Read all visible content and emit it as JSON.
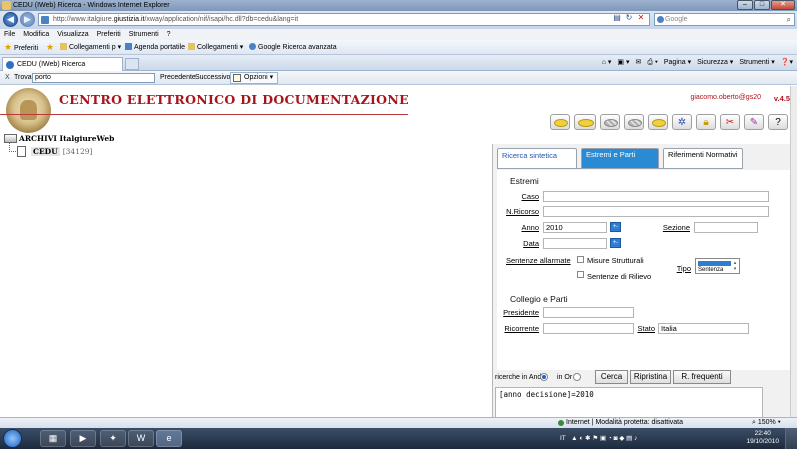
{
  "window": {
    "title": "CEDU (IWeb) Ricerca - Windows Internet Explorer"
  },
  "address": {
    "url_prefix": "http://www.italgiure.",
    "url_host": "giustizia.it",
    "url_suffix": "/xway/application/nif/isapi/hc.dll?db=cedu&lang=it",
    "search_placeholder": "Google"
  },
  "menu": [
    "File",
    "Modifica",
    "Visualizza",
    "Preferiti",
    "Strumenti",
    "?"
  ],
  "favorites": {
    "preferiti": "Preferiti",
    "collegamenti_p": "Collegamenti p",
    "agenda": "Agenda portatile",
    "collegamenti": "Collegamenti",
    "google": "Google Ricerca avanzata"
  },
  "tab": {
    "label": "CEDU (IWeb) Ricerca"
  },
  "commands": [
    "Pagina",
    "Sicurezza",
    "Strumenti"
  ],
  "find": {
    "close": "X",
    "label": "Trova:",
    "value": "porto",
    "prev": "Precedente",
    "next": "Successivo",
    "options": "Opzioni"
  },
  "app": {
    "title": "CENTRO ELETTRONICO DI DOCUMENTAZIONE",
    "user": "giacomo.oberto@gs20",
    "version": "v.4.5"
  },
  "tree": {
    "root": "ARCHIVI ItalgiureWeb",
    "child_name": "CEDU",
    "child_count": "[34129]"
  },
  "tabs": {
    "t1": "Ricerca sintetica",
    "t2": "Estremi e Parti",
    "t3": "Riferimenti Normativi"
  },
  "form": {
    "estremi": "Estremi",
    "caso": "Caso",
    "ricorso": "N.Ricorso",
    "anno": "Anno",
    "anno_value": "2010",
    "sezione": "Sezione",
    "data": "Data",
    "sentenze_allarmate": "Sentenze allarmate",
    "misure": "Misure Strutturali",
    "rilievo": "Sentenze di Rilievo",
    "tipo": "Tipo",
    "tipo_value": "Sentenza",
    "collegio": "Collegio e Parti",
    "presidente": "Presidente",
    "ricorrente": "Ricorrente",
    "stato": "Stato",
    "stato_value": "Italia",
    "pm": "+-"
  },
  "search": {
    "and_label": "ricerche in And",
    "or_label": "in Or",
    "cerca": "Cerca",
    "ripristina": "Ripristina",
    "frequenti": "R. frequenti",
    "result": "[anno decisione]=2010"
  },
  "status": {
    "zone": "Internet | Modalità protetta: disattivata",
    "zoom": "150%"
  },
  "taskbar": {
    "lang": "IT",
    "time": "22:40",
    "date": "19/10/2010"
  }
}
